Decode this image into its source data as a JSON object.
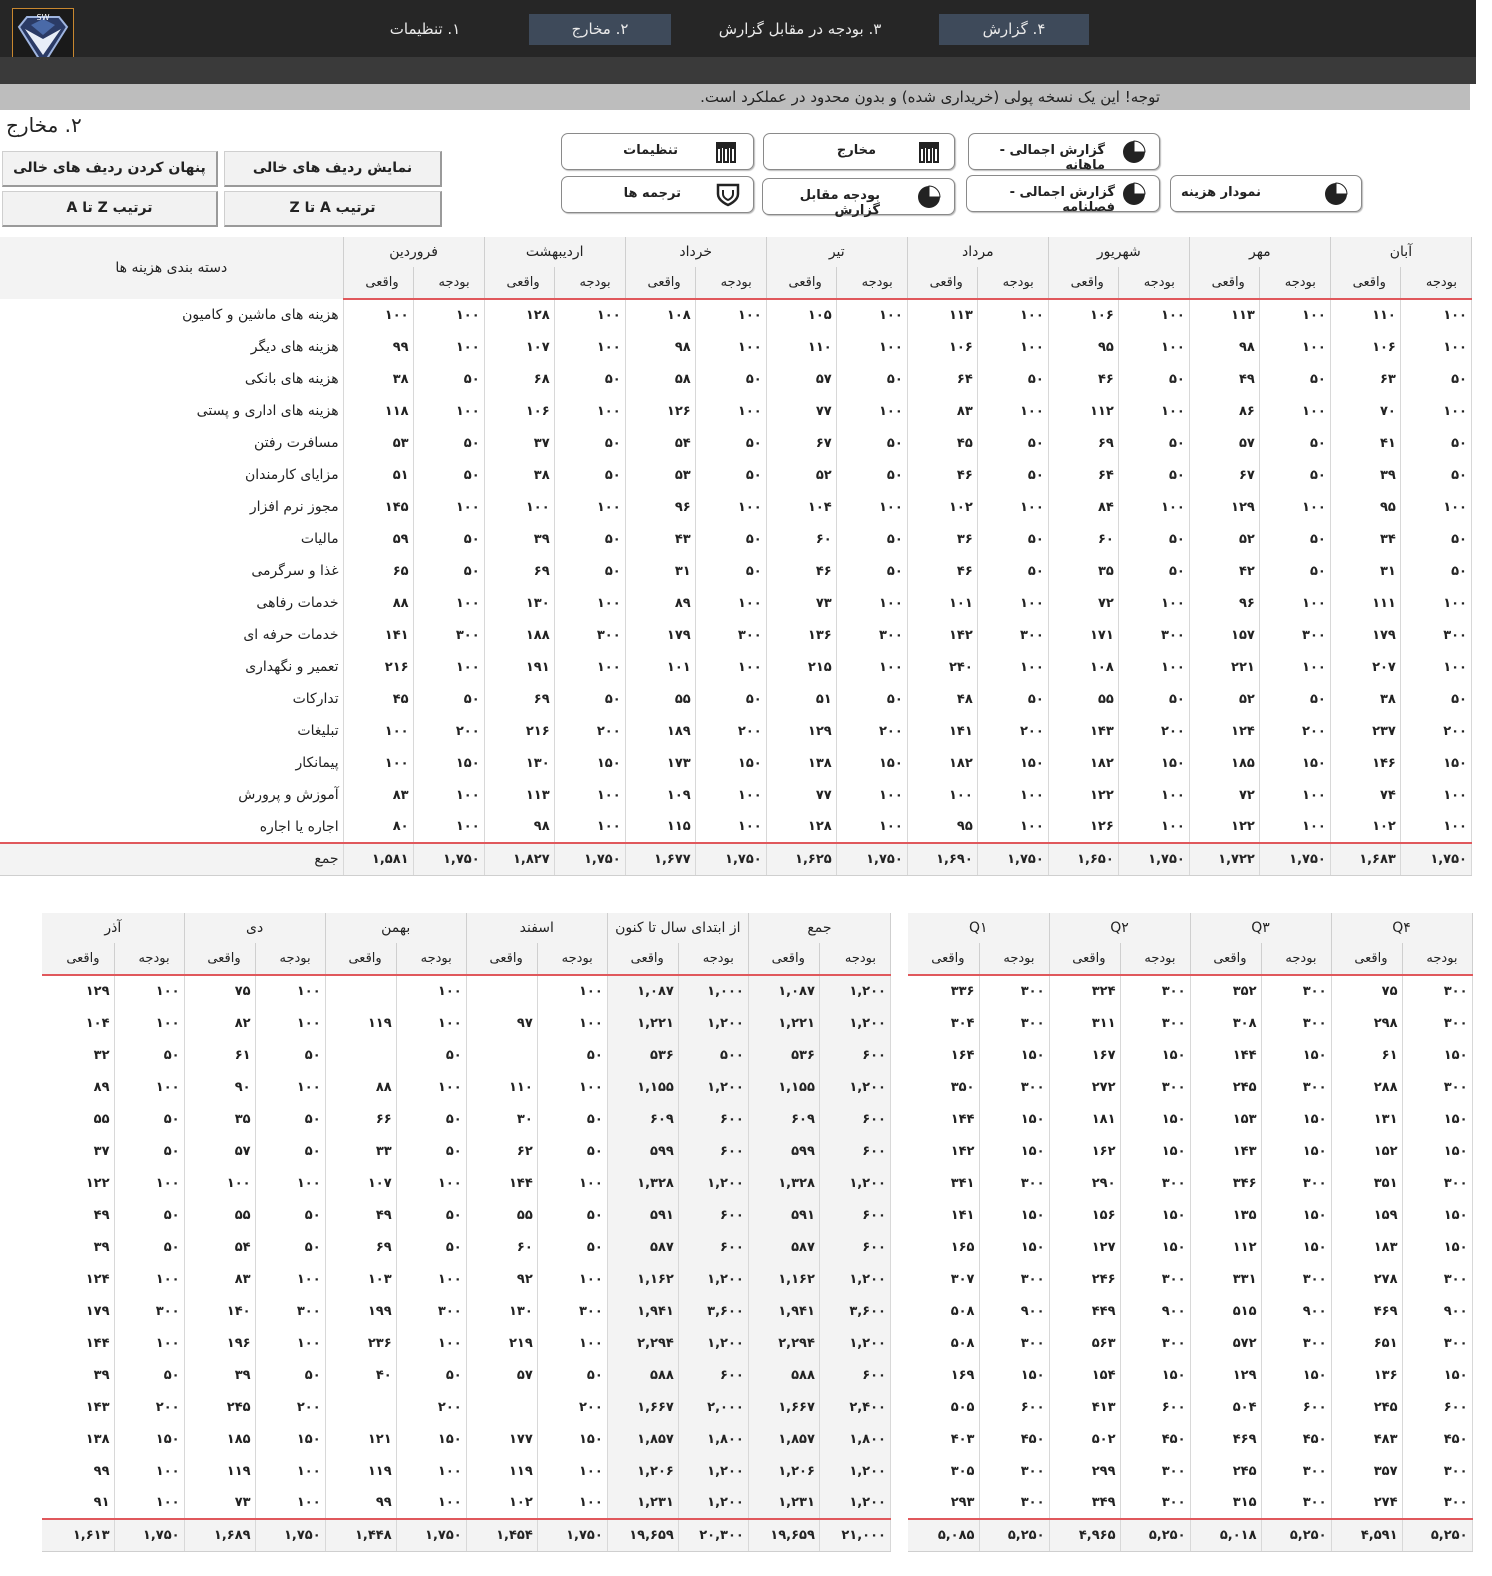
{
  "app": {
    "logo_text": "SW",
    "nav_tabs": [
      "۱. تنظیمات",
      "۲. مخارج",
      "۳. بودجه در مقابل گزارش",
      "۴. گزارش"
    ],
    "active_tab": 1,
    "notice": "توجه! این یک نسخه پولی (خریداری شده) و بدون محدود در عملکرد است.",
    "page_title": "۲. مخارج"
  },
  "controls": {
    "show_empty": "نمایش ردیف های خالی",
    "hide_empty": "پنهان کردن ردیف های خالی",
    "sort_az": "ترتیب A تا Z",
    "sort_za": "ترتیب Z تا A"
  },
  "nav_buttons": {
    "settings": "تنظیمات",
    "expenses": "مخارج",
    "summary_monthly": "گزارش اجمالی - ماهانه",
    "translations": "ترجمه ها",
    "budget_vs_report": "بودجه مقابل گزارش",
    "summary_quarterly": "گزارش اجمالی - فصلنامه",
    "expense_chart": "نمودار هزینه"
  },
  "labels": {
    "category_header": "دسته بندی هزینه ها",
    "budget": "بودجه",
    "actual": "واقعی",
    "total": "جمع",
    "ytd": "از ابتدای سال تا کنون",
    "sum": "جمع"
  },
  "categories": [
    "هزینه های ماشین و کامیون",
    "هزینه های دیگر",
    "هزینه های بانکی",
    "هزینه های اداری و پستی",
    "مسافرت رفتن",
    "مزایای کارمندان",
    "مجوز نرم افزار",
    "مالیات",
    "غذا و سرگرمی",
    "خدمات رفاهی",
    "خدمات حرفه ای",
    "تعمیر و نگهداری",
    "تدارکات",
    "تبلیغات",
    "پیمانکار",
    "آموزش و پرورش",
    "اجاره یا اجاره"
  ],
  "months_top": [
    "فروردین",
    "اردیبهشت",
    "خرداد",
    "تیر",
    "مرداد",
    "شهریور",
    "مهر",
    "آبان"
  ],
  "top_rows": [
    [
      "۱۰۰",
      "۱۰۰",
      "۱۰۰",
      "۱۲۸",
      "۱۰۰",
      "۱۰۸",
      "۱۰۰",
      "۱۰۵",
      "۱۰۰",
      "۱۱۳",
      "۱۰۰",
      "۱۰۶",
      "۱۰۰",
      "۱۱۳",
      "۱۰۰",
      "۱۱۰"
    ],
    [
      "۱۰۰",
      "۹۹",
      "۱۰۰",
      "۱۰۷",
      "۱۰۰",
      "۹۸",
      "۱۰۰",
      "۱۱۰",
      "۱۰۰",
      "۱۰۶",
      "۱۰۰",
      "۹۵",
      "۱۰۰",
      "۹۸",
      "۱۰۰",
      "۱۰۶"
    ],
    [
      "۵۰",
      "۳۸",
      "۵۰",
      "۶۸",
      "۵۰",
      "۵۸",
      "۵۰",
      "۵۷",
      "۵۰",
      "۶۴",
      "۵۰",
      "۴۶",
      "۵۰",
      "۴۹",
      "۵۰",
      "۶۳"
    ],
    [
      "۱۰۰",
      "۱۱۸",
      "۱۰۰",
      "۱۰۶",
      "۱۰۰",
      "۱۲۶",
      "۱۰۰",
      "۷۷",
      "۱۰۰",
      "۸۳",
      "۱۰۰",
      "۱۱۲",
      "۱۰۰",
      "۸۶",
      "۱۰۰",
      "۷۰"
    ],
    [
      "۵۰",
      "۵۳",
      "۵۰",
      "۳۷",
      "۵۰",
      "۵۴",
      "۵۰",
      "۶۷",
      "۵۰",
      "۴۵",
      "۵۰",
      "۶۹",
      "۵۰",
      "۵۷",
      "۵۰",
      "۴۱"
    ],
    [
      "۵۰",
      "۵۱",
      "۵۰",
      "۳۸",
      "۵۰",
      "۵۳",
      "۵۰",
      "۵۲",
      "۵۰",
      "۴۶",
      "۵۰",
      "۶۴",
      "۵۰",
      "۶۷",
      "۵۰",
      "۳۹"
    ],
    [
      "۱۰۰",
      "۱۴۵",
      "۱۰۰",
      "۱۰۰",
      "۱۰۰",
      "۹۶",
      "۱۰۰",
      "۱۰۴",
      "۱۰۰",
      "۱۰۲",
      "۱۰۰",
      "۸۴",
      "۱۰۰",
      "۱۲۹",
      "۱۰۰",
      "۹۵"
    ],
    [
      "۵۰",
      "۵۹",
      "۵۰",
      "۳۹",
      "۵۰",
      "۴۳",
      "۵۰",
      "۶۰",
      "۵۰",
      "۳۶",
      "۵۰",
      "۶۰",
      "۵۰",
      "۵۲",
      "۵۰",
      "۳۴"
    ],
    [
      "۵۰",
      "۶۵",
      "۵۰",
      "۶۹",
      "۵۰",
      "۳۱",
      "۵۰",
      "۴۶",
      "۵۰",
      "۴۶",
      "۵۰",
      "۳۵",
      "۵۰",
      "۴۲",
      "۵۰",
      "۳۱"
    ],
    [
      "۱۰۰",
      "۸۸",
      "۱۰۰",
      "۱۳۰",
      "۱۰۰",
      "۸۹",
      "۱۰۰",
      "۷۳",
      "۱۰۰",
      "۱۰۱",
      "۱۰۰",
      "۷۲",
      "۱۰۰",
      "۹۶",
      "۱۰۰",
      "۱۱۱"
    ],
    [
      "۳۰۰",
      "۱۴۱",
      "۳۰۰",
      "۱۸۸",
      "۳۰۰",
      "۱۷۹",
      "۳۰۰",
      "۱۳۶",
      "۳۰۰",
      "۱۴۲",
      "۳۰۰",
      "۱۷۱",
      "۳۰۰",
      "۱۵۷",
      "۳۰۰",
      "۱۷۹"
    ],
    [
      "۱۰۰",
      "۲۱۶",
      "۱۰۰",
      "۱۹۱",
      "۱۰۰",
      "۱۰۱",
      "۱۰۰",
      "۲۱۵",
      "۱۰۰",
      "۲۴۰",
      "۱۰۰",
      "۱۰۸",
      "۱۰۰",
      "۲۲۱",
      "۱۰۰",
      "۲۰۷"
    ],
    [
      "۵۰",
      "۴۵",
      "۵۰",
      "۶۹",
      "۵۰",
      "۵۵",
      "۵۰",
      "۵۱",
      "۵۰",
      "۴۸",
      "۵۰",
      "۵۵",
      "۵۰",
      "۵۲",
      "۵۰",
      "۳۸"
    ],
    [
      "۲۰۰",
      "۱۰۰",
      "۲۰۰",
      "۲۱۶",
      "۲۰۰",
      "۱۸۹",
      "۲۰۰",
      "۱۲۹",
      "۲۰۰",
      "۱۴۱",
      "۲۰۰",
      "۱۴۳",
      "۲۰۰",
      "۱۲۴",
      "۲۰۰",
      "۲۳۷"
    ],
    [
      "۱۵۰",
      "۱۰۰",
      "۱۵۰",
      "۱۳۰",
      "۱۵۰",
      "۱۷۳",
      "۱۵۰",
      "۱۳۸",
      "۱۵۰",
      "۱۸۲",
      "۱۵۰",
      "۱۸۲",
      "۱۵۰",
      "۱۸۵",
      "۱۵۰",
      "۱۴۶"
    ],
    [
      "۱۰۰",
      "۸۳",
      "۱۰۰",
      "۱۱۳",
      "۱۰۰",
      "۱۰۹",
      "۱۰۰",
      "۷۷",
      "۱۰۰",
      "۱۰۰",
      "۱۰۰",
      "۱۲۲",
      "۱۰۰",
      "۷۲",
      "۱۰۰",
      "۷۴"
    ],
    [
      "۱۰۰",
      "۸۰",
      "۱۰۰",
      "۹۸",
      "۱۰۰",
      "۱۱۵",
      "۱۰۰",
      "۱۲۸",
      "۱۰۰",
      "۹۵",
      "۱۰۰",
      "۱۲۶",
      "۱۰۰",
      "۱۲۲",
      "۱۰۰",
      "۱۰۲"
    ]
  ],
  "top_total": [
    "۱,۷۵۰",
    "۱,۵۸۱",
    "۱,۷۵۰",
    "۱,۸۲۷",
    "۱,۷۵۰",
    "۱,۶۷۷",
    "۱,۷۵۰",
    "۱,۶۲۵",
    "۱,۷۵۰",
    "۱,۶۹۰",
    "۱,۷۵۰",
    "۱,۶۵۰",
    "۱,۷۵۰",
    "۱,۷۲۲",
    "۱,۷۵۰",
    "۱,۶۸۳"
  ],
  "bottom_left_headers": [
    "آذر",
    "دی",
    "بهمن",
    "اسفند",
    "از ابتدای سال تا کنون",
    "جمع"
  ],
  "bottom_left_rows": [
    [
      "۱۰۰",
      "۱۲۹",
      "۱۰۰",
      "۷۵",
      "۱۰۰",
      "",
      "۱۰۰",
      "",
      "۱,۰۰۰",
      "۱,۰۸۷",
      "۱,۲۰۰",
      "۱,۰۸۷"
    ],
    [
      "۱۰۰",
      "۱۰۴",
      "۱۰۰",
      "۸۲",
      "۱۰۰",
      "۱۱۹",
      "۱۰۰",
      "۹۷",
      "۱,۲۰۰",
      "۱,۲۲۱",
      "۱,۲۰۰",
      "۱,۲۲۱"
    ],
    [
      "۵۰",
      "۳۲",
      "۵۰",
      "۶۱",
      "۵۰",
      "",
      "۵۰",
      "",
      "۵۰۰",
      "۵۳۶",
      "۶۰۰",
      "۵۳۶"
    ],
    [
      "۱۰۰",
      "۸۹",
      "۱۰۰",
      "۹۰",
      "۱۰۰",
      "۸۸",
      "۱۰۰",
      "۱۱۰",
      "۱,۲۰۰",
      "۱,۱۵۵",
      "۱,۲۰۰",
      "۱,۱۵۵"
    ],
    [
      "۵۰",
      "۵۵",
      "۵۰",
      "۳۵",
      "۵۰",
      "۶۶",
      "۵۰",
      "۳۰",
      "۶۰۰",
      "۶۰۹",
      "۶۰۰",
      "۶۰۹"
    ],
    [
      "۵۰",
      "۳۷",
      "۵۰",
      "۵۷",
      "۵۰",
      "۳۳",
      "۵۰",
      "۶۲",
      "۶۰۰",
      "۵۹۹",
      "۶۰۰",
      "۵۹۹"
    ],
    [
      "۱۰۰",
      "۱۲۲",
      "۱۰۰",
      "۱۰۰",
      "۱۰۰",
      "۱۰۷",
      "۱۰۰",
      "۱۴۴",
      "۱,۲۰۰",
      "۱,۳۲۸",
      "۱,۲۰۰",
      "۱,۳۲۸"
    ],
    [
      "۵۰",
      "۴۹",
      "۵۰",
      "۵۵",
      "۵۰",
      "۴۹",
      "۵۰",
      "۵۵",
      "۶۰۰",
      "۵۹۱",
      "۶۰۰",
      "۵۹۱"
    ],
    [
      "۵۰",
      "۳۹",
      "۵۰",
      "۵۴",
      "۵۰",
      "۶۹",
      "۵۰",
      "۶۰",
      "۶۰۰",
      "۵۸۷",
      "۶۰۰",
      "۵۸۷"
    ],
    [
      "۱۰۰",
      "۱۲۴",
      "۱۰۰",
      "۸۳",
      "۱۰۰",
      "۱۰۳",
      "۱۰۰",
      "۹۲",
      "۱,۲۰۰",
      "۱,۱۶۲",
      "۱,۲۰۰",
      "۱,۱۶۲"
    ],
    [
      "۳۰۰",
      "۱۷۹",
      "۳۰۰",
      "۱۴۰",
      "۳۰۰",
      "۱۹۹",
      "۳۰۰",
      "۱۳۰",
      "۳,۶۰۰",
      "۱,۹۴۱",
      "۳,۶۰۰",
      "۱,۹۴۱"
    ],
    [
      "۱۰۰",
      "۱۴۴",
      "۱۰۰",
      "۱۹۶",
      "۱۰۰",
      "۲۳۶",
      "۱۰۰",
      "۲۱۹",
      "۱,۲۰۰",
      "۲,۲۹۴",
      "۱,۲۰۰",
      "۲,۲۹۴"
    ],
    [
      "۵۰",
      "۳۹",
      "۵۰",
      "۳۹",
      "۵۰",
      "۴۰",
      "۵۰",
      "۵۷",
      "۶۰۰",
      "۵۸۸",
      "۶۰۰",
      "۵۸۸"
    ],
    [
      "۲۰۰",
      "۱۴۳",
      "۲۰۰",
      "۲۴۵",
      "۲۰۰",
      "",
      "۲۰۰",
      "",
      "۲,۰۰۰",
      "۱,۶۶۷",
      "۲,۴۰۰",
      "۱,۶۶۷"
    ],
    [
      "۱۵۰",
      "۱۳۸",
      "۱۵۰",
      "۱۸۵",
      "۱۵۰",
      "۱۲۱",
      "۱۵۰",
      "۱۷۷",
      "۱,۸۰۰",
      "۱,۸۵۷",
      "۱,۸۰۰",
      "۱,۸۵۷"
    ],
    [
      "۱۰۰",
      "۹۹",
      "۱۰۰",
      "۱۱۹",
      "۱۰۰",
      "۱۱۹",
      "۱۰۰",
      "۱۱۹",
      "۱,۲۰۰",
      "۱,۲۰۶",
      "۱,۲۰۰",
      "۱,۲۰۶"
    ],
    [
      "۱۰۰",
      "۹۱",
      "۱۰۰",
      "۷۳",
      "۱۰۰",
      "۹۹",
      "۱۰۰",
      "۱۰۲",
      "۱,۲۰۰",
      "۱,۲۳۱",
      "۱,۲۰۰",
      "۱,۲۳۱"
    ]
  ],
  "bottom_left_total": [
    "۱,۷۵۰",
    "۱,۶۱۳",
    "۱,۷۵۰",
    "۱,۶۸۹",
    "۱,۷۵۰",
    "۱,۴۴۸",
    "۱,۷۵۰",
    "۱,۴۵۴",
    "۲۰,۳۰۰",
    "۱۹,۶۵۹",
    "۲۱,۰۰۰",
    "۱۹,۶۵۹"
  ],
  "quarters": [
    "Q۱",
    "Q۲",
    "Q۳",
    "Q۴"
  ],
  "bottom_right_rows": [
    [
      "۳۰۰",
      "۳۳۶",
      "۳۰۰",
      "۳۲۴",
      "۳۰۰",
      "۳۵۲",
      "۳۰۰",
      "۷۵"
    ],
    [
      "۳۰۰",
      "۳۰۴",
      "۳۰۰",
      "۳۱۱",
      "۳۰۰",
      "۳۰۸",
      "۳۰۰",
      "۲۹۸"
    ],
    [
      "۱۵۰",
      "۱۶۴",
      "۱۵۰",
      "۱۶۷",
      "۱۵۰",
      "۱۴۴",
      "۱۵۰",
      "۶۱"
    ],
    [
      "۳۰۰",
      "۳۵۰",
      "۳۰۰",
      "۲۷۲",
      "۳۰۰",
      "۲۴۵",
      "۳۰۰",
      "۲۸۸"
    ],
    [
      "۱۵۰",
      "۱۴۴",
      "۱۵۰",
      "۱۸۱",
      "۱۵۰",
      "۱۵۳",
      "۱۵۰",
      "۱۳۱"
    ],
    [
      "۱۵۰",
      "۱۴۲",
      "۱۵۰",
      "۱۶۲",
      "۱۵۰",
      "۱۴۳",
      "۱۵۰",
      "۱۵۲"
    ],
    [
      "۳۰۰",
      "۳۴۱",
      "۳۰۰",
      "۲۹۰",
      "۳۰۰",
      "۳۴۶",
      "۳۰۰",
      "۳۵۱"
    ],
    [
      "۱۵۰",
      "۱۴۱",
      "۱۵۰",
      "۱۵۶",
      "۱۵۰",
      "۱۳۵",
      "۱۵۰",
      "۱۵۹"
    ],
    [
      "۱۵۰",
      "۱۶۵",
      "۱۵۰",
      "۱۲۷",
      "۱۵۰",
      "۱۱۲",
      "۱۵۰",
      "۱۸۳"
    ],
    [
      "۳۰۰",
      "۳۰۷",
      "۳۰۰",
      "۲۴۶",
      "۳۰۰",
      "۳۳۱",
      "۳۰۰",
      "۲۷۸"
    ],
    [
      "۹۰۰",
      "۵۰۸",
      "۹۰۰",
      "۴۴۹",
      "۹۰۰",
      "۵۱۵",
      "۹۰۰",
      "۴۶۹"
    ],
    [
      "۳۰۰",
      "۵۰۸",
      "۳۰۰",
      "۵۶۳",
      "۳۰۰",
      "۵۷۲",
      "۳۰۰",
      "۶۵۱"
    ],
    [
      "۱۵۰",
      "۱۶۹",
      "۱۵۰",
      "۱۵۴",
      "۱۵۰",
      "۱۲۹",
      "۱۵۰",
      "۱۳۶"
    ],
    [
      "۶۰۰",
      "۵۰۵",
      "۶۰۰",
      "۴۱۳",
      "۶۰۰",
      "۵۰۴",
      "۶۰۰",
      "۲۴۵"
    ],
    [
      "۴۵۰",
      "۴۰۳",
      "۴۵۰",
      "۵۰۲",
      "۴۵۰",
      "۴۶۹",
      "۴۵۰",
      "۴۸۳"
    ],
    [
      "۳۰۰",
      "۳۰۵",
      "۳۰۰",
      "۲۹۹",
      "۳۰۰",
      "۲۴۵",
      "۳۰۰",
      "۳۵۷"
    ],
    [
      "۳۰۰",
      "۲۹۳",
      "۳۰۰",
      "۳۴۹",
      "۳۰۰",
      "۳۱۵",
      "۳۰۰",
      "۲۷۴"
    ]
  ],
  "bottom_right_total": [
    "۵,۲۵۰",
    "۵,۰۸۵",
    "۵,۲۵۰",
    "۴,۹۶۵",
    "۵,۲۵۰",
    "۵,۰۱۸",
    "۵,۲۵۰",
    "۴,۵۹۱"
  ]
}
